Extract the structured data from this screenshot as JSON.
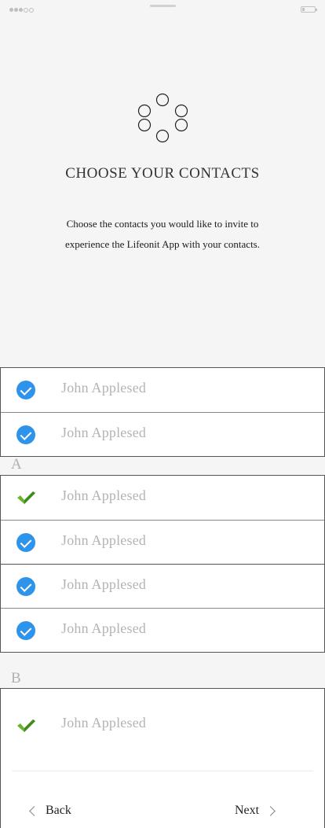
{
  "header": {
    "title": "CHOOSE YOUR CONTACTS",
    "subtitle": "Choose the contacts you would like to invite to experience the Lifeonit App with your contacts."
  },
  "contacts_top": [
    {
      "name": "John Applesed",
      "check": "blue-check"
    },
    {
      "name": "John Applesed",
      "check": "blue-check"
    }
  ],
  "section_a": {
    "letter": "A",
    "contacts": [
      {
        "name": "John Applesed",
        "check": "green-check"
      },
      {
        "name": "John Applesed",
        "check": "blue-check"
      },
      {
        "name": "John Applesed",
        "check": "blue-check"
      },
      {
        "name": "John Applesed",
        "check": "blue-check"
      }
    ]
  },
  "section_b": {
    "letter": "B",
    "contacts": [
      {
        "name": "John Applesed",
        "check": "green-check"
      }
    ]
  },
  "footer": {
    "back_label": "Back",
    "next_label": "Next"
  },
  "colors": {
    "accent_blue": "#2e93ea",
    "accent_green": "#6ab42d",
    "background": "#f5f5f5"
  }
}
